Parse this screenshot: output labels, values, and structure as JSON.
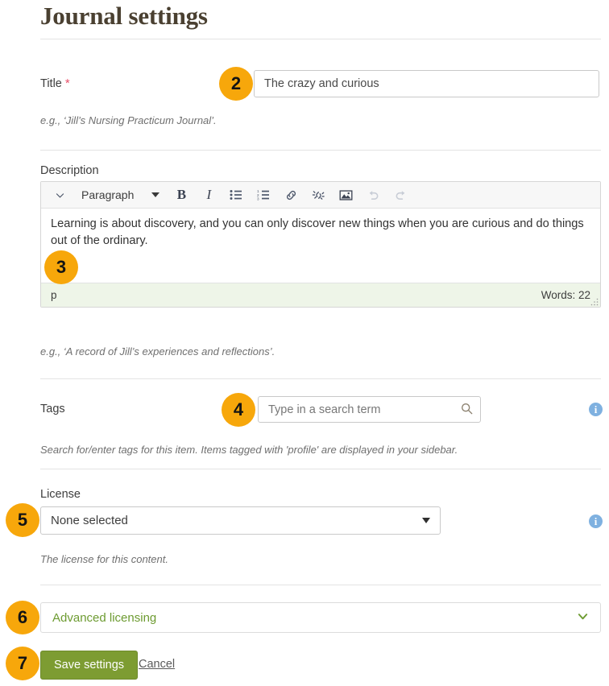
{
  "page": {
    "title": "Journal settings"
  },
  "title_field": {
    "label": "Title",
    "required_marker": "*",
    "value": "The crazy and curious",
    "placeholder": "",
    "hint": "e.g., ‘Jill’s Nursing Practicum Journal’."
  },
  "description_field": {
    "label": "Description",
    "toolbar": {
      "collapse_label": "⌄",
      "format_label": "Paragraph",
      "bold_label": "B",
      "italic_label": "I",
      "bullet_list_label": "bullet-list",
      "numbered_list_label": "numbered-list",
      "link_label": "link",
      "unlink_label": "unlink",
      "image_label": "image",
      "undo_label": "undo",
      "redo_label": "redo"
    },
    "content": "Learning is about discovery, and you can only discover new things when you are curious and do things out of the ordinary.",
    "status_path": "p",
    "word_count": "Words: 22",
    "hint": "e.g., ‘A record of Jill’s experiences and reflections’."
  },
  "tags_field": {
    "label": "Tags",
    "placeholder": "Type in a search term",
    "value": "",
    "hint": "Search for/enter tags for this item. Items tagged with 'profile' are displayed in your sidebar.",
    "info_glyph": "i"
  },
  "license_field": {
    "label": "License",
    "selected": "None selected",
    "options": [
      "None selected"
    ],
    "hint": "The license for this content.",
    "info_glyph": "i"
  },
  "advanced_licensing": {
    "label": "Advanced licensing",
    "chevron": "chevron-down"
  },
  "actions": {
    "save_label": "Save settings",
    "cancel_label": "Cancel"
  },
  "badges": {
    "title": "2",
    "description": "3",
    "tags": "4",
    "license": "5",
    "advanced": "6",
    "save": "7"
  },
  "colors": {
    "badge": "#f7a70b",
    "primary_button": "#7d9c32",
    "heading": "#4a4031",
    "info": "#7fb1e0",
    "status_bar": "#eef5e8",
    "required": "#e8506a"
  }
}
